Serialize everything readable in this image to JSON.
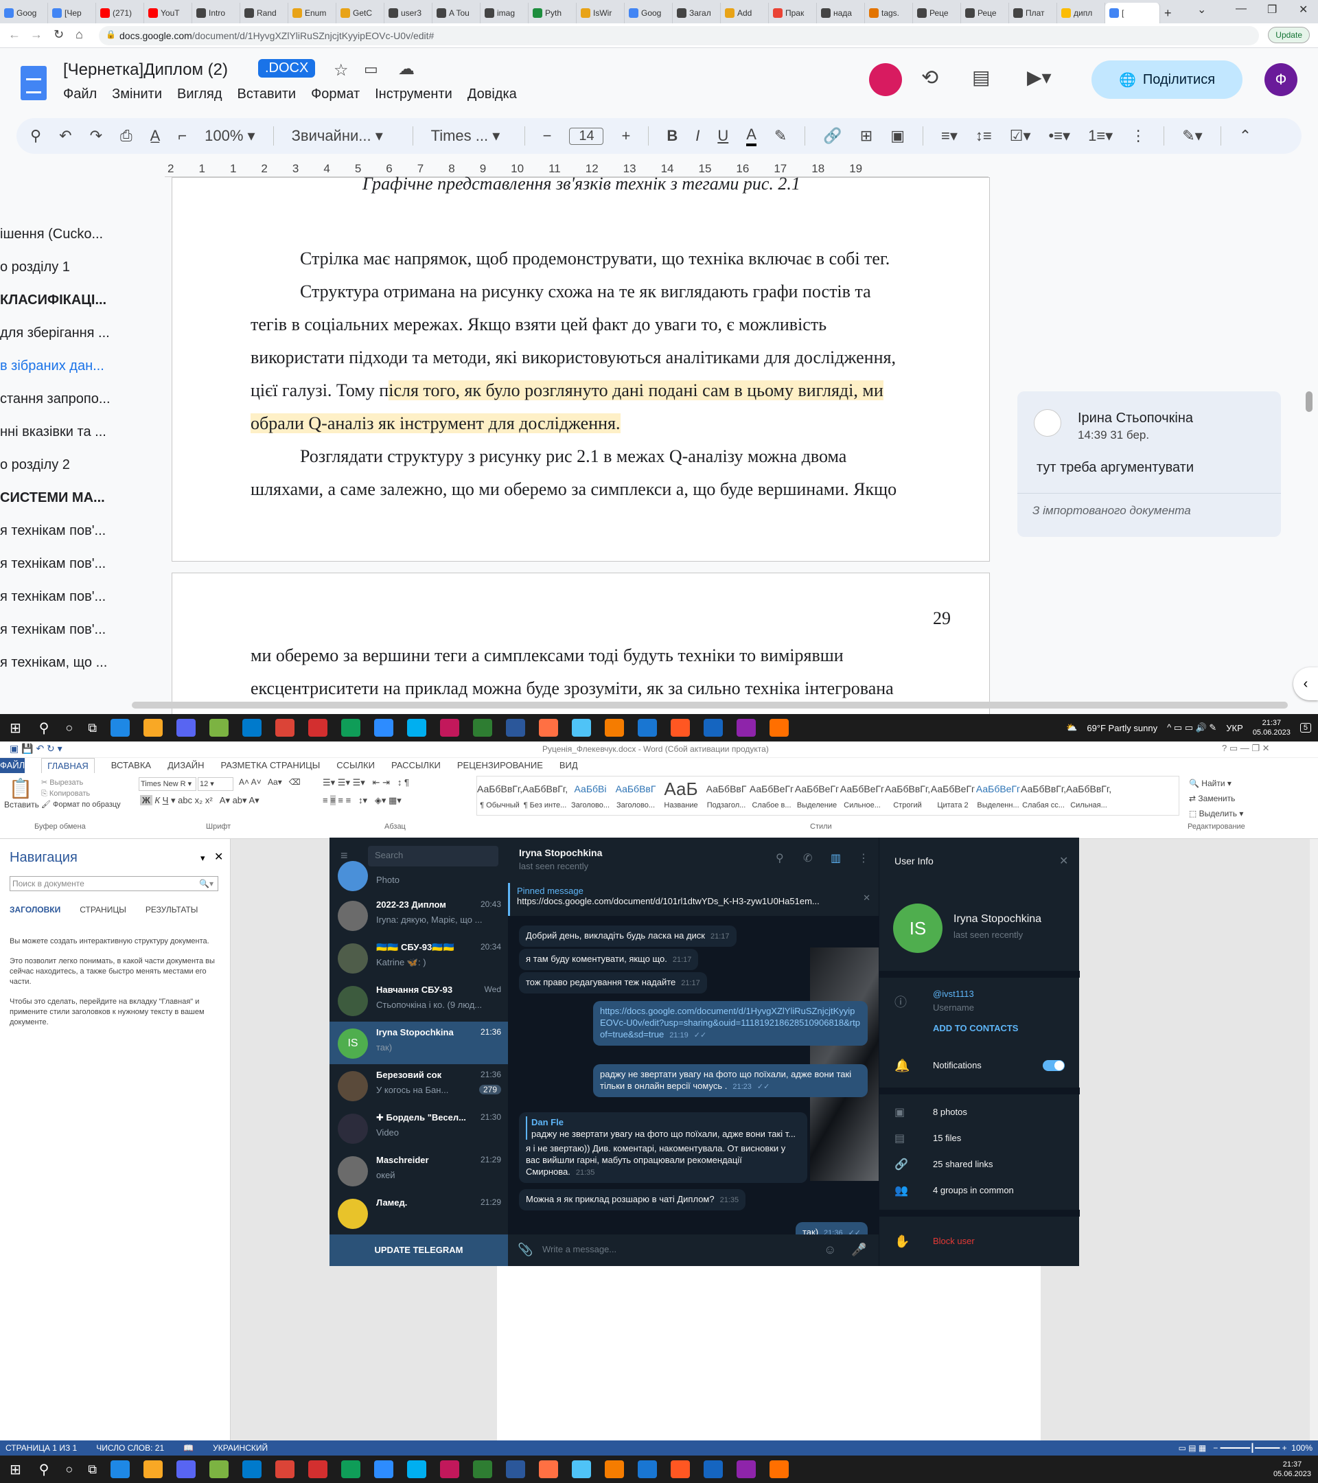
{
  "browser": {
    "tabs": [
      "Goog",
      "[Чер",
      "(271)",
      "YouT",
      "Intro",
      "Rand",
      "Enum",
      "GetC",
      "user3",
      "A Tou",
      "imag",
      "Pyth",
      "IsWir",
      "Goog",
      "Загал",
      "Add",
      "Прак",
      "надa",
      "tags.",
      "Реце",
      "Реце",
      "Плат",
      "дипл",
      "["
    ],
    "active_tab_index": 23,
    "url_host": "docs.google.com",
    "url_path": "/document/d/1HyvgXZlYliRuSZnjcjtKyyipEOVc-U0v/edit#",
    "update_label": "Update"
  },
  "docs": {
    "title": "[Чернетка]Диплом (2)",
    "badge": ".DOCX",
    "menu": [
      "Файл",
      "Змінити",
      "Вигляд",
      "Вставити",
      "Формат",
      "Інструменти",
      "Довідка"
    ],
    "share_label": "Поділитися",
    "profile_initial": "Ф",
    "toolbar": {
      "zoom": "100%",
      "style": "Звичайни...",
      "font": "Times ...",
      "size": "14"
    },
    "ruler_ticks": [
      "2",
      "1",
      "1",
      "2",
      "3",
      "4",
      "5",
      "6",
      "7",
      "8",
      "9",
      "10",
      "11",
      "12",
      "13",
      "14",
      "15",
      "16",
      "17",
      "18",
      "19"
    ],
    "outline": [
      "ішення (Cucko...",
      "о розділу 1",
      "КЛАСИФІКАЦІ...",
      "для зберігання ...",
      "в зібраних дан...",
      "стання запропо...",
      "нні вказівки та ...",
      "о розділу 2",
      "СИСТЕМИ МА...",
      "я технікам пов'...",
      "я технікам пов'...",
      "я технікам пов'...",
      "я технікам пов'...",
      "я технікам, що ..."
    ],
    "caption": "Графічне представлення зв'язків технік з тегами рис. 2.1",
    "para1": "Стрілка має напрямок, щоб продемонструвати, що техніка включає в собі тег.",
    "para2_lines": [
      "Структура отримана на рисунку схожа на те як виглядають графи постів та",
      "тегів в соціальних мережах. Якщо взяти цей факт до уваги то, є можливість",
      "використати підходи та методи, які використовуються  аналітиками для дослідження,"
    ],
    "para2_tail_plain": "цієї галузі. Тому п",
    "para2_tail_hl": "ісля того, як було розглянуто дані подані сам в цьому вигляді, ми",
    "para2_last_hl": "обрали Q-аналіз як інструмент для дослідження.",
    "para3_lines": [
      "Розглядати структуру з рисунку рис 2.1 в межах Q-аналізу можна двома",
      "шляхами, а саме залежно, що ми оберемо за симплекси а, що буде вершинами. Якщо"
    ],
    "page_number": "29",
    "page2_lines": [
      "ми оберемо за вершини теги а симплексами тоді будуть техніки то вимірявши",
      "ексцентриситети на приклад можна буде зрозуміти, як за сильно техніка інтегрована"
    ],
    "comment": {
      "author": "Ірина Стьопочкіна",
      "time": "14:39 31 бер.",
      "text": "тут треба аргументувати",
      "footer": "З імпортованого документа"
    }
  },
  "taskbar": {
    "weather": "69°F  Partly sunny",
    "lang": "УКР",
    "time": "21:37",
    "date": "05.06.2023",
    "notif": "5"
  },
  "word": {
    "title": "Руценія_Флекевчук.docx - Word (Сбой активации продукта)",
    "tabs": [
      "ФАЙЛ",
      "ГЛАВНАЯ",
      "ВСТАВКА",
      "ДИЗАЙН",
      "РАЗМЕТКА СТРАНИЦЫ",
      "ССЫЛКИ",
      "РАССЫЛКИ",
      "РЕЦЕНЗИРОВАНИЕ",
      "ВИД"
    ],
    "clipboard": [
      "Вставить",
      "Вырезать",
      "Копировать",
      "Формат по образцу"
    ],
    "font_name": "Times New R",
    "font_size": "12",
    "styles": [
      {
        "sample": "АаБбВвГг,",
        "name": "¶ Обычный"
      },
      {
        "sample": "АаБбВвГг,",
        "name": "¶ Без инте..."
      },
      {
        "sample": "АаБбВі",
        "name": "Заголово..."
      },
      {
        "sample": "АаБбВвГ",
        "name": "Заголово..."
      },
      {
        "sample": "АаБ",
        "name": "Название"
      },
      {
        "sample": "АаБбВвГ",
        "name": "Подзагол..."
      },
      {
        "sample": "АаБбВеГг",
        "name": "Слабое в..."
      },
      {
        "sample": "АаБбВеГг",
        "name": "Выделение"
      },
      {
        "sample": "АаБбВеГг",
        "name": "Сильное..."
      },
      {
        "sample": "АаБбВвГг,",
        "name": "Строгий"
      },
      {
        "sample": "АаБбВеГг",
        "name": "Цитата 2"
      },
      {
        "sample": "АаБбВеГг",
        "name": "Выделенн..."
      },
      {
        "sample": "АаБбВвГг,",
        "name": "Слабая сс..."
      },
      {
        "sample": "АаБбВвГг,",
        "name": "Сильная..."
      }
    ],
    "editing": [
      "Найти",
      "Заменить",
      "Выделить"
    ],
    "groups": [
      "Буфер обмена",
      "Шрифт",
      "Абзац",
      "Стили",
      "Редактирование"
    ],
    "nav": {
      "title": "Навигация",
      "search_placeholder": "Поиск в документе",
      "tabs": [
        "ЗАГОЛОВКИ",
        "СТРАНИЦЫ",
        "РЕЗУЛЬТАТЫ"
      ],
      "help": [
        "Вы можете создать интерактивную структуру документа.",
        "Это позволит легко понимать, в какой части документа вы сейчас находитесь, а также быстро менять местами его части.",
        "Чтобы это сделать, перейдите на вкладку \"Главная\" и примените стили заголовков к нужному тексту в вашем документе."
      ]
    },
    "status": [
      "СТРАНИЦА 1 ИЗ 1",
      "ЧИСЛО СЛОВ: 21",
      "УКРАИНСКИЙ"
    ],
    "zoom": "100%"
  },
  "telegram": {
    "search_placeholder": "Search",
    "chats": [
      {
        "name": "",
        "preview": "Photo",
        "time": "",
        "color": "#4a90d9"
      },
      {
        "name": "2022-23 Диплом",
        "preview": "Iryna: дякую, Маріє, що ...",
        "time": "20:43",
        "color": "#6b6b6b"
      },
      {
        "name": "🇺🇦🇺🇦 СБУ-93🇺🇦🇺🇦",
        "preview": "Katrine 🦋: )",
        "time": "20:34",
        "color": "#4f5d4a"
      },
      {
        "name": "Навчання СБУ-93",
        "preview": "Стьопочкіна і ко. (9 люд...",
        "time": "Wed",
        "color": "#3d5b3e"
      },
      {
        "name": "Iryna Stopochkina",
        "preview": "так)",
        "time": "21:36",
        "color": "#4fae4e",
        "initials": "IS"
      },
      {
        "name": "Березовий сок",
        "preview": "У когось на Бан...",
        "time": "21:36",
        "color": "#5a4a3a",
        "badge": "279"
      },
      {
        "name": "✚ Бордель \"Весел...",
        "preview": "Video",
        "time": "21:30",
        "color": "#2c2c3c"
      },
      {
        "name": "Maschreider",
        "preview": "окей",
        "time": "21:29",
        "color": "#6b6b6b"
      },
      {
        "name": "Ламед.",
        "preview": "",
        "time": "21:29",
        "color": "#e8c32a"
      }
    ],
    "active_chat_index": 4,
    "update_label": "UPDATE TELEGRAM",
    "header": {
      "name": "Iryna Stopochkina",
      "status": "last seen recently"
    },
    "pinned": {
      "label": "Pinned message",
      "text": "https://docs.google.com/document/d/101rl1dtwYDs_K-H3-zyw1U0Ha51em..."
    },
    "messages": [
      {
        "dir": "in",
        "text": "Добрий день, викладіть будь ласка на диск",
        "time": "21:17"
      },
      {
        "dir": "in",
        "text": "я там буду коментувати, якщо що.",
        "time": "21:17"
      },
      {
        "dir": "in",
        "text": "тож право редагування теж надайте",
        "time": "21:17"
      },
      {
        "dir": "out",
        "text": "https://docs.google.com/document/d/1HyvgXZlYliRuSZnjcjtKyyipEOVc-U0v/edit?usp=sharing&ouid=111819218628510906818&rtpof=true&sd=true",
        "time": "21:19"
      },
      {
        "dir": "out",
        "text": "раджу не звертати увагу на фото що поїхали, адже вони такі тільки в онлайн версії чомусь .",
        "time": "21:23"
      },
      {
        "dir": "in",
        "reply_author": "Dan Fle",
        "reply_text": "раджу не звертати увагу на фото що поїхали, адже вони такі т...",
        "text": "я і не звертаю)) Див. коментарі, накоментувала. От висновки у вас вийшли гарні, мабуть опрацювали рекомендації Смирнова.",
        "time": "21:35"
      },
      {
        "dir": "in",
        "text": "Можна я як приклад розшарю в чаті Диплом?",
        "time": "21:35"
      },
      {
        "dir": "out",
        "text": "так)",
        "time": "21:36"
      }
    ],
    "input_placeholder": "Write a message...",
    "user_info": {
      "title": "User Info",
      "initials": "IS",
      "name": "Iryna Stopochkina",
      "status": "last seen recently",
      "username": "@ivst1113",
      "username_label": "Username",
      "add_contacts": "ADD TO CONTACTS",
      "notifications": "Notifications",
      "photos": "8 photos",
      "files": "15 files",
      "links": "25 shared links",
      "groups": "4 groups in common",
      "block": "Block user"
    }
  }
}
